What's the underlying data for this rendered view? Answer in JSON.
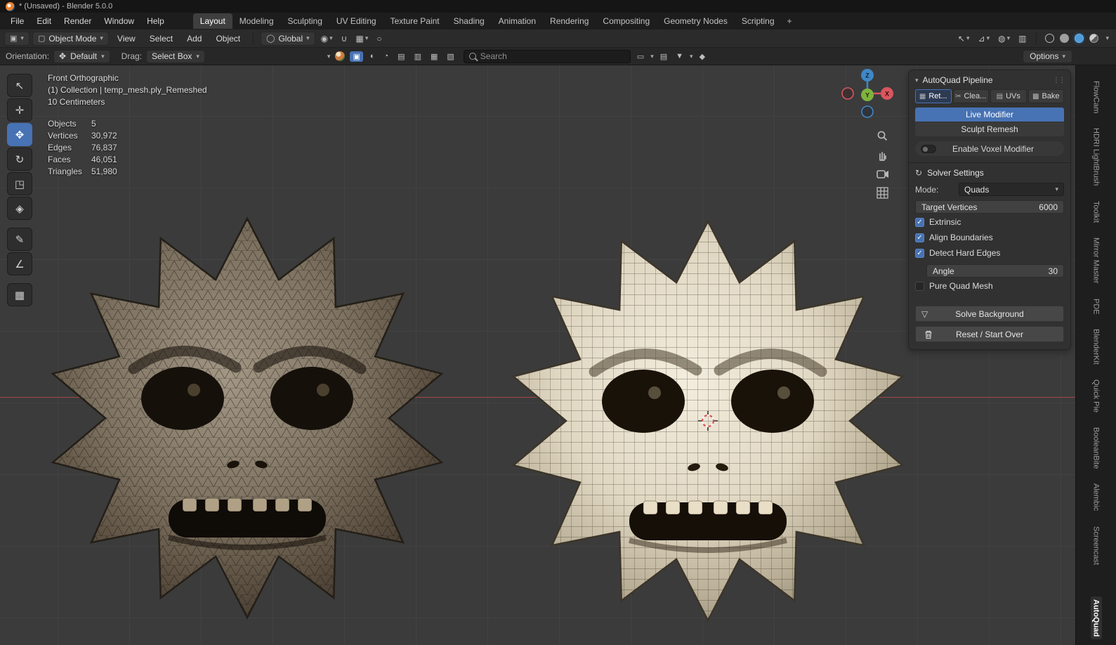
{
  "titlebar": {
    "title": "* (Unsaved) - Blender 5.0.0"
  },
  "menubar": {
    "menus": [
      "File",
      "Edit",
      "Render",
      "Window",
      "Help"
    ],
    "workspaces": [
      "Layout",
      "Modeling",
      "Sculpting",
      "UV Editing",
      "Texture Paint",
      "Shading",
      "Animation",
      "Rendering",
      "Compositing",
      "Geometry Nodes",
      "Scripting"
    ],
    "active_workspace": "Layout",
    "add_workspace": "+"
  },
  "viewport_header": {
    "mode": "Object Mode",
    "menus": [
      "View",
      "Select",
      "Add",
      "Object"
    ],
    "transform_orientation": "Global"
  },
  "tool_settings": {
    "orientation_label": "Orientation:",
    "orientation_value": "Default",
    "drag_label": "Drag:",
    "drag_value": "Select Box",
    "search_placeholder": "Search",
    "options_label": "Options"
  },
  "viewport": {
    "view_name": "Front Orthographic",
    "collection_path": "(1) Collection | temp_mesh.ply_Remeshed",
    "units": "10 Centimeters",
    "stats": [
      {
        "label": "Objects",
        "value": "5"
      },
      {
        "label": "Vertices",
        "value": "30,972"
      },
      {
        "label": "Edges",
        "value": "76,837"
      },
      {
        "label": "Faces",
        "value": "46,051"
      },
      {
        "label": "Triangles",
        "value": "51,980"
      }
    ],
    "axis_labels": {
      "x": "X",
      "y": "Y",
      "z": "Z"
    }
  },
  "panel": {
    "title": "AutoQuad Pipeline",
    "tabs": [
      {
        "label": "Ret..."
      },
      {
        "label": "Clea..."
      },
      {
        "label": "UVs"
      },
      {
        "label": "Bake"
      }
    ],
    "live_modifier": "Live Modifier",
    "sculpt_remesh": "Sculpt Remesh",
    "enable_voxel": "Enable Voxel Modifier",
    "solver": {
      "title": "Solver Settings",
      "mode_label": "Mode:",
      "mode_value": "Quads",
      "target_vertices_label": "Target Vertices",
      "target_vertices_value": "6000",
      "checkboxes": [
        {
          "label": "Extrinsic",
          "checked": true
        },
        {
          "label": "Align Boundaries",
          "checked": true
        },
        {
          "label": "Detect Hard Edges",
          "checked": true
        }
      ],
      "angle_label": "Angle",
      "angle_value": "30",
      "pure_quad_label": "Pure Quad Mesh",
      "pure_quad_checked": false,
      "solve_label": "Solve Background",
      "reset_label": "Reset / Start Over"
    }
  },
  "sidebar_tabs": [
    "FlowCam",
    "HDRI LightBrush",
    "Toolkit",
    "Mirror Master",
    "PDE",
    "BlenderKit",
    "Quick Pie",
    "BooleanBite",
    "Alembic",
    "Screencast",
    "AutoQuad"
  ],
  "sidebar_active_tab": "AutoQuad",
  "icons": {
    "chevron": "▾",
    "select": "↖",
    "cursor": "✛",
    "move": "✥",
    "rotate": "↻",
    "scale": "◳",
    "transform": "◈",
    "annotate": "✎",
    "measure": "∠",
    "add_cube": "▦",
    "editor_type": "▣",
    "mode_object": "▢",
    "orientation_global": "◯",
    "pivot": "◉",
    "magnet": "∪",
    "proportional": "○",
    "visibility": "↖",
    "gizmos": "⊿",
    "overlays": "◍",
    "xray": "▥",
    "blue_square": "▣",
    "half_sphere": "◐",
    "circle": "◔",
    "grid_a": "▤",
    "grid_b": "▥",
    "grid_c": "▦",
    "grid_d": "▧",
    "region_box": "▭",
    "clipboard": "▤",
    "funnel": "▼",
    "shield": "◆",
    "retopo_tab": "▦",
    "cleanup_tab": "✂",
    "uvs_tab": "▤",
    "bake_tab": "▩",
    "solver": "↻",
    "solve": "▽",
    "grip": "⋮⋮",
    "collapse": "▾"
  },
  "colors": {
    "accent_blue": "#4772b3",
    "axis_x_red": "#d9565f",
    "axis_y_green": "#7fb33c",
    "axis_z_blue": "#3f87c7",
    "viewport_bg": "#3b3b3b",
    "x_axis_line": "#c74e4e"
  }
}
